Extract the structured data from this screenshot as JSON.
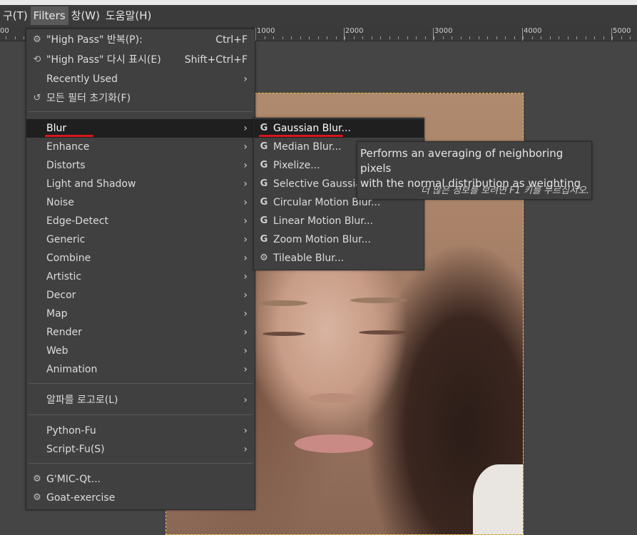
{
  "menubar": {
    "items": [
      {
        "label": "구(T)"
      },
      {
        "label": "Filters"
      },
      {
        "label": "창(W)"
      },
      {
        "label": "도움말(H)"
      }
    ]
  },
  "ruler": {
    "labels": [
      "00",
      "1000",
      "2000",
      "3000",
      "4000",
      "5000"
    ]
  },
  "filters_menu": {
    "repeat": {
      "label": "\"High Pass\" 반복(P):",
      "shortcut": "Ctrl+F",
      "icon": "gear-icon"
    },
    "reshow": {
      "label": "\"High Pass\" 다시 표시(E)",
      "shortcut": "Shift+Ctrl+F",
      "icon": "reshow-icon"
    },
    "recently_used": {
      "label": "Recently Used"
    },
    "reset": {
      "label": "모든 필터 초기화(F)",
      "icon": "reset-icon"
    },
    "categories": [
      {
        "label": "Blur"
      },
      {
        "label": "Enhance"
      },
      {
        "label": "Distorts"
      },
      {
        "label": "Light and Shadow"
      },
      {
        "label": "Noise"
      },
      {
        "label": "Edge-Detect"
      },
      {
        "label": "Generic"
      },
      {
        "label": "Combine"
      },
      {
        "label": "Artistic"
      },
      {
        "label": "Decor"
      },
      {
        "label": "Map"
      },
      {
        "label": "Render"
      },
      {
        "label": "Web"
      },
      {
        "label": "Animation"
      }
    ],
    "alpha_to_logo": {
      "label": "알파를 로고로(L)"
    },
    "python_fu": {
      "label": "Python-Fu"
    },
    "script_fu": {
      "label": "Script-Fu(S)"
    },
    "gmic": {
      "label": "G'MIC-Qt...",
      "icon": "plugin-icon"
    },
    "goat": {
      "label": "Goat-exercise",
      "icon": "plugin-icon"
    }
  },
  "blur_submenu": {
    "items": [
      {
        "label": "Gaussian Blur...",
        "icon": "gegl-icon"
      },
      {
        "label": "Median Blur...",
        "icon": "gegl-icon"
      },
      {
        "label": "Pixelize...",
        "icon": "gegl-icon"
      },
      {
        "label": "Selective Gaussian",
        "icon": "gegl-icon"
      },
      {
        "label": "Circular Motion Blur...",
        "icon": "gegl-icon"
      },
      {
        "label": "Linear Motion Blur...",
        "icon": "gegl-icon"
      },
      {
        "label": "Zoom Motion Blur...",
        "icon": "gegl-icon"
      },
      {
        "label": "Tileable Blur...",
        "icon": "plugin-icon"
      }
    ]
  },
  "tooltip": {
    "line1": "Performs an averaging of neighboring pixels",
    "line2": "with the normal distribution as weighting",
    "hint": "더 많은 정보를 보려면 F1 키를 누르십시오."
  },
  "colors": {
    "menu_bg": "#404040",
    "highlight": "#1f1f1f",
    "red_underline": "#d8161b",
    "selection_border": "#e8c64a"
  }
}
